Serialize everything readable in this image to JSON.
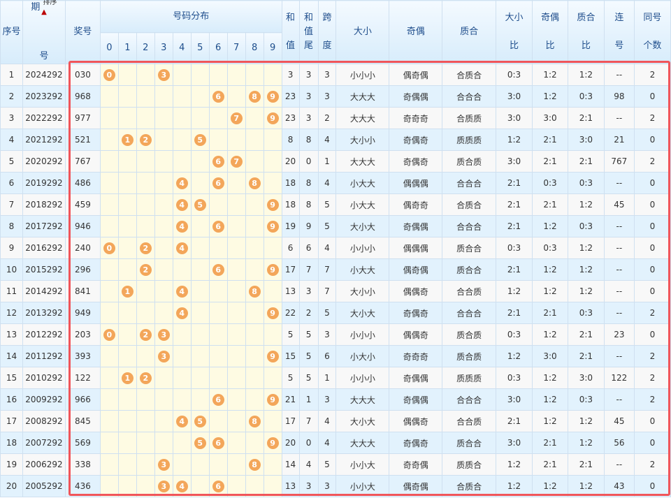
{
  "headers": {
    "seq": "序号",
    "period_a": "期",
    "period_b": "号",
    "sort": "排序",
    "prize": "奖号",
    "dist": "号码分布",
    "digits": [
      "0",
      "1",
      "2",
      "3",
      "4",
      "5",
      "6",
      "7",
      "8",
      "9"
    ],
    "sum_a": "和",
    "sum_b": "值",
    "tail_a": "和",
    "tail_b": "值",
    "tail_c": "尾",
    "span_a": "跨",
    "span_b": "度",
    "bs": "大小",
    "oe": "奇偶",
    "pc": "质合",
    "bsr_a": "大小",
    "bsr_b": "比",
    "oer_a": "奇偶",
    "oer_b": "比",
    "pcr_a": "质合",
    "pcr_b": "比",
    "con_a": "连",
    "con_b": "号",
    "same_a": "同号",
    "same_b": "个数"
  },
  "rows": [
    [
      "1",
      "2024292",
      "030",
      "3",
      "3",
      "3",
      "小小小",
      "偶奇偶",
      "合质合",
      "0:3",
      "1:2",
      "1:2",
      "--",
      "2"
    ],
    [
      "2",
      "2023292",
      "968",
      "23",
      "3",
      "3",
      "大大大",
      "奇偶偶",
      "合合合",
      "3:0",
      "1:2",
      "0:3",
      "98",
      "0"
    ],
    [
      "3",
      "2022292",
      "977",
      "23",
      "3",
      "2",
      "大大大",
      "奇奇奇",
      "合质质",
      "3:0",
      "3:0",
      "2:1",
      "--",
      "2"
    ],
    [
      "4",
      "2021292",
      "521",
      "8",
      "8",
      "4",
      "大小小",
      "奇偶奇",
      "质质质",
      "1:2",
      "2:1",
      "3:0",
      "21",
      "0"
    ],
    [
      "5",
      "2020292",
      "767",
      "20",
      "0",
      "1",
      "大大大",
      "奇偶奇",
      "质合质",
      "3:0",
      "2:1",
      "2:1",
      "767",
      "2"
    ],
    [
      "6",
      "2019292",
      "486",
      "18",
      "8",
      "4",
      "小大大",
      "偶偶偶",
      "合合合",
      "2:1",
      "0:3",
      "0:3",
      "--",
      "0"
    ],
    [
      "7",
      "2018292",
      "459",
      "18",
      "8",
      "5",
      "小大大",
      "偶奇奇",
      "合质合",
      "2:1",
      "2:1",
      "1:2",
      "45",
      "0"
    ],
    [
      "8",
      "2017292",
      "946",
      "19",
      "9",
      "5",
      "大小大",
      "奇偶偶",
      "合合合",
      "2:1",
      "1:2",
      "0:3",
      "--",
      "0"
    ],
    [
      "9",
      "2016292",
      "240",
      "6",
      "6",
      "4",
      "小小小",
      "偶偶偶",
      "质合合",
      "0:3",
      "0:3",
      "1:2",
      "--",
      "0"
    ],
    [
      "10",
      "2015292",
      "296",
      "17",
      "7",
      "7",
      "小大大",
      "偶奇偶",
      "质合合",
      "2:1",
      "1:2",
      "1:2",
      "--",
      "0"
    ],
    [
      "11",
      "2014292",
      "841",
      "13",
      "3",
      "7",
      "大小小",
      "偶偶奇",
      "合合质",
      "1:2",
      "1:2",
      "1:2",
      "--",
      "0"
    ],
    [
      "12",
      "2013292",
      "949",
      "22",
      "2",
      "5",
      "大小大",
      "奇偶奇",
      "合合合",
      "2:1",
      "2:1",
      "0:3",
      "--",
      "2"
    ],
    [
      "13",
      "2012292",
      "203",
      "5",
      "5",
      "3",
      "小小小",
      "偶偶奇",
      "质合质",
      "0:3",
      "1:2",
      "2:1",
      "23",
      "0"
    ],
    [
      "14",
      "2011292",
      "393",
      "15",
      "5",
      "6",
      "小大小",
      "奇奇奇",
      "质合质",
      "1:2",
      "3:0",
      "2:1",
      "--",
      "2"
    ],
    [
      "15",
      "2010292",
      "122",
      "5",
      "5",
      "1",
      "小小小",
      "奇偶偶",
      "质质质",
      "0:3",
      "1:2",
      "3:0",
      "122",
      "2"
    ],
    [
      "16",
      "2009292",
      "966",
      "21",
      "1",
      "3",
      "大大大",
      "奇偶偶",
      "合合合",
      "3:0",
      "1:2",
      "0:3",
      "--",
      "2"
    ],
    [
      "17",
      "2008292",
      "845",
      "17",
      "7",
      "4",
      "大小大",
      "偶偶奇",
      "合合质",
      "2:1",
      "1:2",
      "1:2",
      "45",
      "0"
    ],
    [
      "18",
      "2007292",
      "569",
      "20",
      "0",
      "4",
      "大大大",
      "奇偶奇",
      "质合合",
      "3:0",
      "2:1",
      "1:2",
      "56",
      "0"
    ],
    [
      "19",
      "2006292",
      "338",
      "14",
      "4",
      "5",
      "小小大",
      "奇奇偶",
      "质质合",
      "1:2",
      "2:1",
      "2:1",
      "--",
      "2"
    ],
    [
      "20",
      "2005292",
      "436",
      "13",
      "3",
      "3",
      "小小大",
      "偶奇偶",
      "合质合",
      "1:2",
      "1:2",
      "1:2",
      "43",
      "0"
    ]
  ],
  "colors": {
    "ball": "#f3a65a",
    "highlight": "#f0555a"
  }
}
